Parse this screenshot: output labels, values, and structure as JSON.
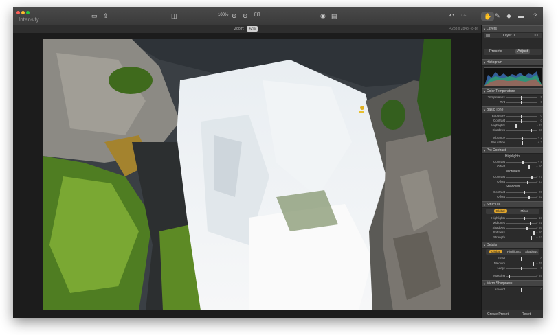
{
  "app": {
    "title": "Intensify"
  },
  "toolbar": {
    "zoom_100": "100%",
    "fit": "FIT",
    "icons": [
      "folder-icon",
      "share-icon",
      "compare-icon",
      "zoom-in-icon",
      "zoom-out-icon",
      "eye-icon",
      "split-view-icon",
      "undo-icon",
      "redo-icon",
      "hand-icon",
      "brush-icon",
      "eraser-icon",
      "gradient-icon",
      "help-icon"
    ]
  },
  "zoombar": {
    "label": "Zoom:",
    "value": "42%",
    "dims": "4288 x 2848 · 8-bit"
  },
  "panel": {
    "layers": {
      "title": "Layers",
      "layer_name": "Layer 0",
      "opacity": "100"
    },
    "tabs": {
      "presets": "Presets",
      "adjust": "Adjust"
    },
    "histogram": {
      "title": "Histogram"
    },
    "color_temperature": {
      "title": "Color Temperature",
      "rows": [
        {
          "label": "Temperature",
          "value": "0",
          "pos": 0.5
        },
        {
          "label": "Tint",
          "value": "0",
          "pos": 0.5
        }
      ]
    },
    "basic_tone": {
      "title": "Basic Tone",
      "rows": [
        {
          "label": "Exposure",
          "value": "0",
          "pos": 0.5
        },
        {
          "label": "Contrast",
          "value": "0",
          "pos": 0.5
        },
        {
          "label": "Highlights",
          "value": "- 37",
          "pos": 0.32
        },
        {
          "label": "Shadows",
          "value": "+ 68",
          "pos": 0.82
        },
        {
          "label": "Vibrance",
          "value": "+ 2",
          "pos": 0.52
        },
        {
          "label": "Saturation",
          "value": "+ 3",
          "pos": 0.53
        }
      ]
    },
    "pro_contrast": {
      "title": "Pro Contrast",
      "sub_highlights": "Highlights",
      "sub_midtones": "Midtones",
      "sub_shadows": "Shadows",
      "highlights": [
        {
          "label": "Contrast",
          "value": "+ 8",
          "pos": 0.54
        },
        {
          "label": "Offset",
          "value": "+ 50",
          "pos": 0.75
        }
      ],
      "midtones": [
        {
          "label": "Contrast",
          "value": "+ 71",
          "pos": 0.85
        },
        {
          "label": "Offset",
          "value": "+ 43",
          "pos": 0.71
        }
      ],
      "shadows": [
        {
          "label": "Contrast",
          "value": "+ 20",
          "pos": 0.6
        },
        {
          "label": "Offset",
          "value": "+ 52",
          "pos": 0.76
        }
      ]
    },
    "structure": {
      "title": "Structure",
      "seg": [
        "Global",
        "Micro"
      ],
      "rows": [
        {
          "label": "Highlights",
          "value": "+ 18",
          "pos": 0.59
        },
        {
          "label": "Midtones",
          "value": "+ 61",
          "pos": 0.8
        },
        {
          "label": "Shadows",
          "value": "+ 36",
          "pos": 0.68
        },
        {
          "label": "Softness",
          "value": "+ 80",
          "pos": 0.9
        },
        {
          "label": "Strength",
          "value": "+ 62",
          "pos": 0.81
        }
      ]
    },
    "details": {
      "title": "Details",
      "seg": [
        "Global",
        "Highlights",
        "Shadows"
      ],
      "rows": [
        {
          "label": "Small",
          "value": "0",
          "pos": 0.5
        },
        {
          "label": "Medium",
          "value": "+ 76",
          "pos": 0.88
        },
        {
          "label": "Large",
          "value": "0",
          "pos": 0.5
        },
        {
          "label": "Masking",
          "value": "+ 35",
          "pos": 0.1
        }
      ]
    },
    "micro_sharpness": {
      "title": "Micro Sharpness",
      "rows": [
        {
          "label": "Amount",
          "value": "0",
          "pos": 0.5
        }
      ]
    },
    "bottom": {
      "create_preset": "Create Preset",
      "reset": "Reset"
    }
  },
  "colors": {
    "accent": "#e0a52b"
  }
}
